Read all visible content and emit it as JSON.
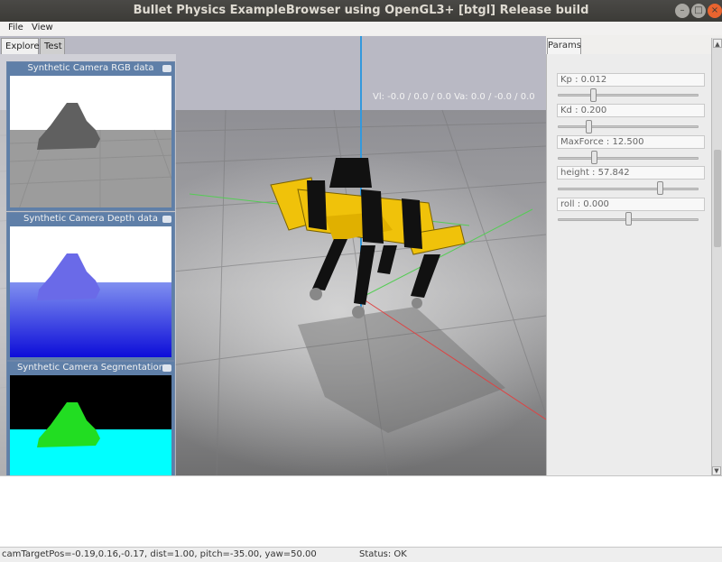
{
  "window": {
    "title": "Bullet Physics ExampleBrowser using OpenGL3+ [btgl] Release build",
    "min_glyph": "–",
    "max_glyph": "□",
    "close_glyph": "×"
  },
  "menu": {
    "file": "File",
    "view": "View"
  },
  "explorer": {
    "tabs": [
      {
        "label": "Explorer"
      },
      {
        "label": "Test"
      }
    ],
    "camera_panels": [
      {
        "title": "Synthetic Camera RGB data"
      },
      {
        "title": "Synthetic Camera Depth data"
      },
      {
        "title": "Synthetic Camera Segmentation Mask"
      }
    ]
  },
  "viewport": {
    "velocity_readout": "Vl: -0.0 / 0.0 / 0.0 Va: 0.0 / -0.0 / 0.0"
  },
  "params": {
    "tab_label": "Params",
    "items": [
      {
        "label": "Kp : 0.012",
        "slider_value": 0.24
      },
      {
        "label": "Kd : 0.200",
        "slider_value": 0.21
      },
      {
        "label": "MaxForce : 12.500",
        "slider_value": 0.25
      },
      {
        "label": "height : 57.842",
        "slider_value": 0.74
      },
      {
        "label": "roll : 0.000",
        "slider_value": 0.5
      }
    ]
  },
  "status": {
    "camera": "camTargetPos=-0.19,0.16,-0.17, dist=1.00, pitch=-35.00, yaw=50.00",
    "app": "Status: OK"
  },
  "colors": {
    "robot_body": "#f0c20a",
    "robot_joint": "#1a1a1a",
    "floor": "#a0a0a0",
    "sky": "#b9b9c4",
    "segmentation_bg": "#00ffff",
    "segmentation_robot": "#22dd22",
    "depth_blue": "#1a2be0"
  }
}
